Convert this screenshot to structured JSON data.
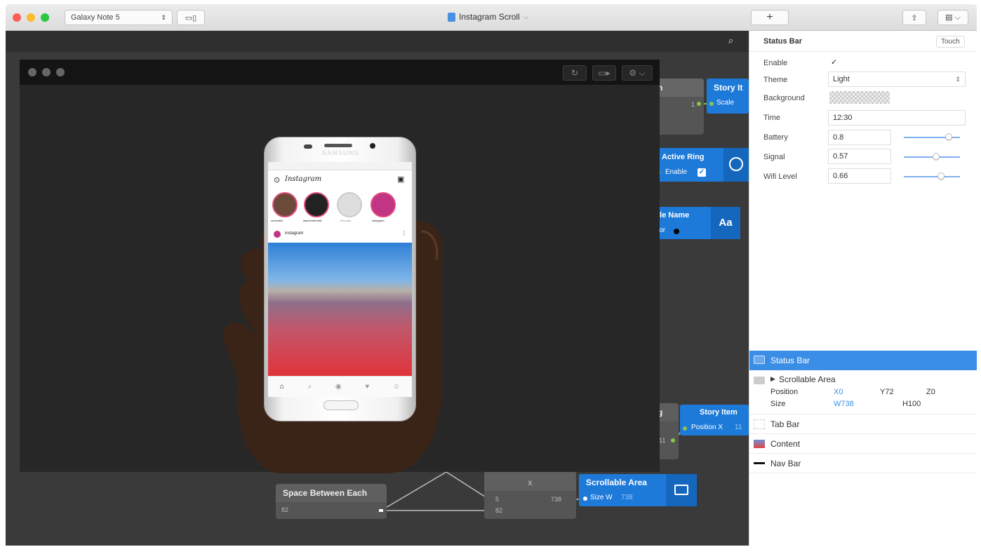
{
  "titlebar": {
    "device": "Galaxy Note 5",
    "document_title": "Instagram Scroll",
    "add_label": "+"
  },
  "canvas": {
    "nodes": {
      "n_partial_top": "n",
      "story_item_top": "Story It",
      "scale_port": "Scale",
      "scale_value": "1",
      "active_ring": "Active Ring",
      "enable_port": "Enable",
      "file_name": "ile Name",
      "file_name_sub": "lor",
      "aa_label": "Aa",
      "g_partial": "g",
      "story_item_bottom": "Story Item",
      "position_x_port": "Position X",
      "position_x_value": "11",
      "left_value": "11",
      "space_between": "Space Between Each",
      "space_value": "82",
      "scroll_x": "x",
      "in_value_1": "5",
      "in_value_2": "82",
      "out_value": "738",
      "scrollable_area": "Scrollable Area",
      "size_w_port": "Size W",
      "size_w_value": "738"
    }
  },
  "phone": {
    "brand": "SAMSUNG",
    "app_name": "Instagram",
    "post_user": "instagram",
    "stories": [
      "cecbettini",
      "itsamemehollie",
      "dinomtw",
      "instagram"
    ]
  },
  "panel": {
    "header": "Status Bar",
    "touch_button": "Touch",
    "props": {
      "enable_label": "Enable",
      "enable_value": "✓",
      "theme_label": "Theme",
      "theme_value": "Light",
      "background_label": "Background",
      "time_label": "Time",
      "time_value": "12:30",
      "battery_label": "Battery",
      "battery_value": "0.8",
      "signal_label": "Signal",
      "signal_value": "0.57",
      "wifi_label": "Wifi Level",
      "wifi_value": "0.66"
    },
    "sliders": {
      "battery": 0.8,
      "signal": 0.57,
      "wifi": 0.66
    },
    "layers": {
      "selected": "Status Bar",
      "scrollable": "Scrollable Area",
      "position_label": "Position",
      "pos_x": "X0",
      "pos_y": "Y72",
      "pos_z": "Z0",
      "size_label": "Size",
      "size_w": "W738",
      "size_h": "H100",
      "tab_bar": "Tab Bar",
      "content": "Content",
      "nav_bar": "Nav Bar"
    },
    "accent": "#3b8ee6"
  }
}
